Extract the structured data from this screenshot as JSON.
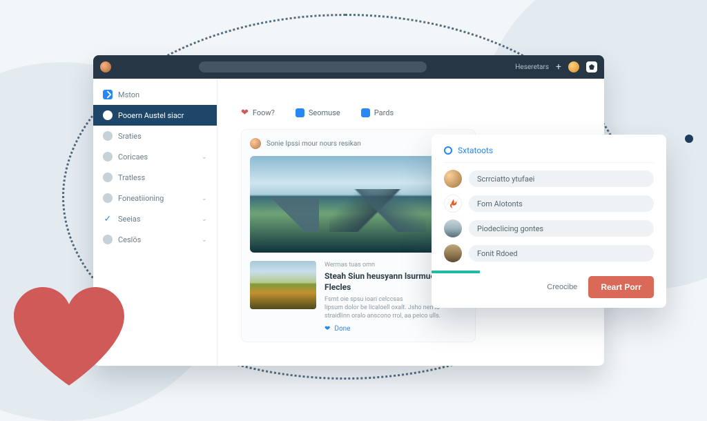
{
  "header": {
    "right_label": "Heseretars",
    "plus_label": "+"
  },
  "sidebar": {
    "items": [
      {
        "icon": "square",
        "label": "Mston",
        "expandable": false
      },
      {
        "icon": "dot",
        "label": "Pooern Austel siacr",
        "expandable": false,
        "active": true
      },
      {
        "icon": "dot",
        "label": "Sraties",
        "expandable": false
      },
      {
        "icon": "dot",
        "label": "Coricaes",
        "expandable": true
      },
      {
        "icon": "dot",
        "label": "Tratless",
        "expandable": false
      },
      {
        "icon": "dot",
        "label": "Foneatiioning",
        "expandable": true
      },
      {
        "icon": "check",
        "label": "Seeias",
        "expandable": true
      },
      {
        "icon": "dot",
        "label": "Ceslös",
        "expandable": true
      }
    ]
  },
  "tabs": [
    {
      "kind": "heart",
      "label": "Foow?"
    },
    {
      "kind": "box",
      "label": "Seomuse"
    },
    {
      "kind": "box",
      "label": "Pards"
    }
  ],
  "card": {
    "byline": "Sonie Ipssi mour nours resikan",
    "kicker": "Wermas tuas omn",
    "title": "Steah Siun heusyann lsurmue Tfor Flecles",
    "body1": "Fsrnt oie spsu ioari celccsas",
    "body2": "lipsum dolor be licaloell oxalt. Jsho nen lo straidlinn oralo anscono rrol, aa peico ulls.",
    "meta_action": "Done"
  },
  "modal": {
    "title": "Sxtatoots",
    "items": [
      {
        "label": "Scrrciatto ytufaei"
      },
      {
        "label": "Fom Alotonts"
      },
      {
        "label": "Piodeclicing gontes"
      },
      {
        "label": "Fonit Rdoed"
      }
    ],
    "secondary": "Creocibe",
    "primary": "Reart Porr"
  },
  "colors": {
    "brand_navy": "#263645",
    "accent_blue": "#2787f5",
    "accent_teal": "#1fb9a8",
    "accent_red": "#d86a57",
    "heart": "#cf5a57"
  }
}
